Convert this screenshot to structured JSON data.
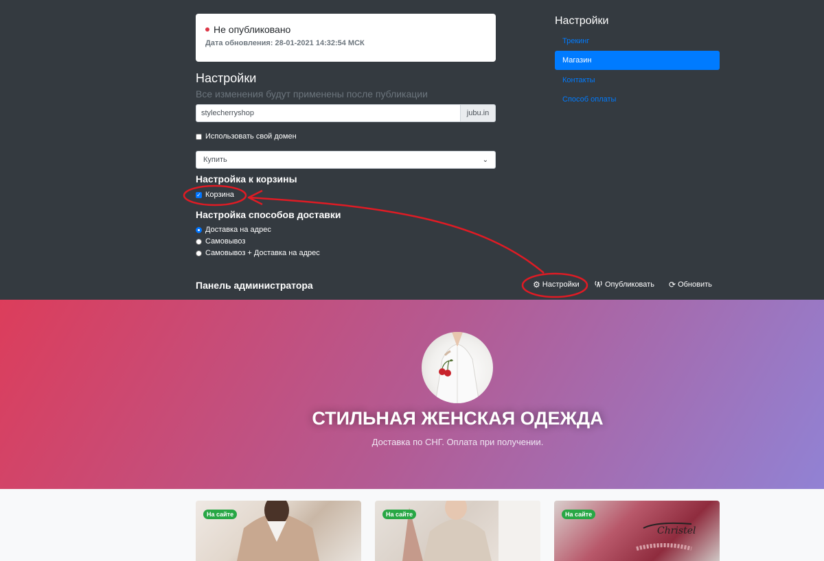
{
  "status": {
    "label": "Не опубликовано",
    "updated": "Дата обновления: 28-01-2021 14:32:54 МСК",
    "dot_color": "#dc3545"
  },
  "settings": {
    "title": "Настройки",
    "hint": "Все изменения будут применены после публикации",
    "domain_value": "stylecherryshop",
    "domain_suffix": "jubu.in",
    "own_domain_label": "Использовать свой домен",
    "own_domain_checked": false,
    "select_value": "Купить",
    "cart_section": "Настройка к корзины",
    "cart_label": "Корзина",
    "cart_checked": true,
    "delivery_section": "Настройка способов доставки",
    "delivery_options": [
      {
        "label": "Доставка на адрес",
        "checked": true
      },
      {
        "label": "Самовывоз",
        "checked": false
      },
      {
        "label": "Самовывоз + Доставка на адрес",
        "checked": false
      }
    ]
  },
  "sidebar": {
    "title": "Настройки",
    "items": [
      {
        "label": "Трекинг",
        "active": false
      },
      {
        "label": "Магазин",
        "active": true
      },
      {
        "label": "Контакты",
        "active": false
      },
      {
        "label": "Способ оплаты",
        "active": false
      }
    ]
  },
  "admin_bar": {
    "title": "Панель администратора",
    "actions": [
      {
        "label": "Настройки",
        "icon": "gear-icon"
      },
      {
        "label": "Опубликовать",
        "icon": "broadcast-icon"
      },
      {
        "label": "Обновить",
        "icon": "refresh-icon"
      }
    ]
  },
  "hero": {
    "title": "СТИЛЬНАЯ ЖЕНСКАЯ ОДЕЖДА",
    "subtitle": "Доставка по СНГ. Оплата при получении."
  },
  "products": [
    {
      "badge": "На сайте"
    },
    {
      "badge": "На сайте"
    },
    {
      "badge": "На сайте"
    }
  ],
  "colors": {
    "admin_bg": "#343a40",
    "accent": "#007bff",
    "badge": "#28a745",
    "annotation": "#e01b24"
  }
}
